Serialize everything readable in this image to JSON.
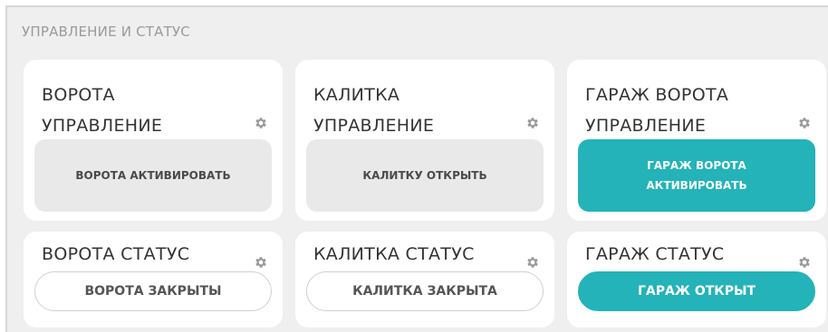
{
  "panel": {
    "title": "УПРАВЛЕНИЕ И СТАТУС"
  },
  "control_cards": [
    {
      "title": "ВОРОТА\nУПРАВЛЕНИЕ",
      "button": "ВОРОТА АКТИВИРОВАТЬ"
    },
    {
      "title": "КАЛИТКА\nУПРАВЛЕНИЕ",
      "button": "КАЛИТКУ ОТКРЫТЬ"
    },
    {
      "title": "ГАРАЖ ВОРОТА\nУПРАВЛЕНИЕ",
      "button": "ГАРАЖ ВОРОТА\nАКТИВИРОВАТЬ"
    }
  ],
  "status_cards": [
    {
      "title": "ВОРОТА СТАТУС",
      "status": "ВОРОТА ЗАКРЫТЫ"
    },
    {
      "title": "КАЛИТКА СТАТУС",
      "status": "КАЛИТКА ЗАКРЫТА"
    },
    {
      "title": "ГАРАЖ СТАТУС",
      "status": "ГАРАЖ ОТКРЫТ"
    }
  ],
  "colors": {
    "accent": "#23b3b8",
    "panel_bg": "#efefef",
    "card_bg": "#ffffff",
    "button_idle": "#e9e9e9"
  },
  "icons": {
    "settings": "gear-icon"
  }
}
